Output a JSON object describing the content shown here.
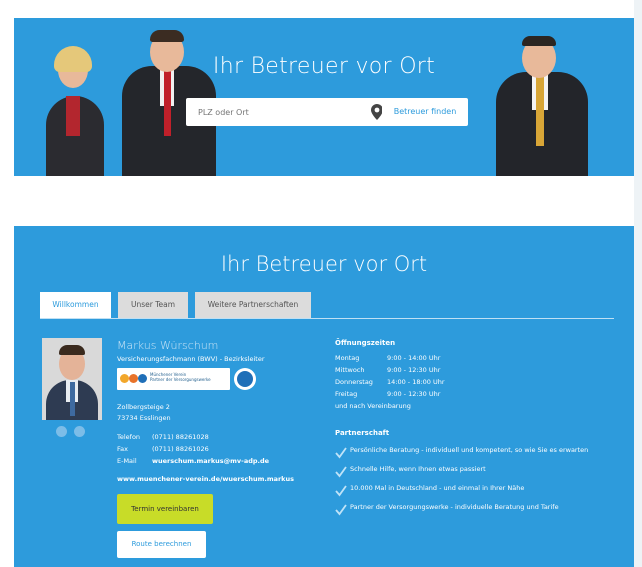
{
  "hero": {
    "title": "Ihr Betreuer vor Ort",
    "search_placeholder": "PLZ oder Ort",
    "find_button": "Betreuer finden"
  },
  "section": {
    "title": "Ihr Betreuer vor Ort",
    "tabs": [
      {
        "label": "Willkommen",
        "active": true
      },
      {
        "label": "Unser Team",
        "active": false
      },
      {
        "label": "Weitere Partnerschaften",
        "active": false
      }
    ]
  },
  "agent": {
    "name": "Markus Würschum",
    "role": "Versicherungsfachmann (BWV) - Bezirksleiter",
    "badge_text": "Münchener Verein\nPartner der Versorgungswerke",
    "address_line1": "Zollbergsteige 2",
    "address_line2": "73734 Esslingen",
    "contacts": [
      {
        "label": "Telefon",
        "value": "(0711) 88261028"
      },
      {
        "label": "Fax",
        "value": "(0711) 88261026"
      },
      {
        "label": "E-Mail",
        "value": "wuerschum.markus@mv-adp.de"
      }
    ],
    "website": "www.muenchener-verein.de/wuerschum.markus",
    "appointment_button": "Termin vereinbaren",
    "route_button": "Route berechnen"
  },
  "hours": {
    "heading": "Öffnungszeiten",
    "rows": [
      {
        "day": "Montag",
        "time": "9:00 - 14:00 Uhr"
      },
      {
        "day": "Mittwoch",
        "time": "9:00 - 12:30 Uhr"
      },
      {
        "day": "Donnerstag",
        "time": "14:00 - 18:00 Uhr"
      },
      {
        "day": "Freitag",
        "time": "9:00 - 12:30 Uhr"
      }
    ],
    "note": "und nach Vereinbarung"
  },
  "partnership": {
    "heading": "Partnerschaft",
    "items": [
      "Persönliche Beratung - individuell und kompetent, so wie Sie es erwarten",
      "Schnelle Hilfe, wenn Ihnen etwas passiert",
      "10.000 Mal in Deutschland - und einmal in Ihrer Nähe",
      "Partner der Versorgungswerke - individuelle Beratung und Tarife"
    ]
  },
  "colors": {
    "brand_blue": "#2d9bdc",
    "accent_yellow": "#c8dc28"
  }
}
